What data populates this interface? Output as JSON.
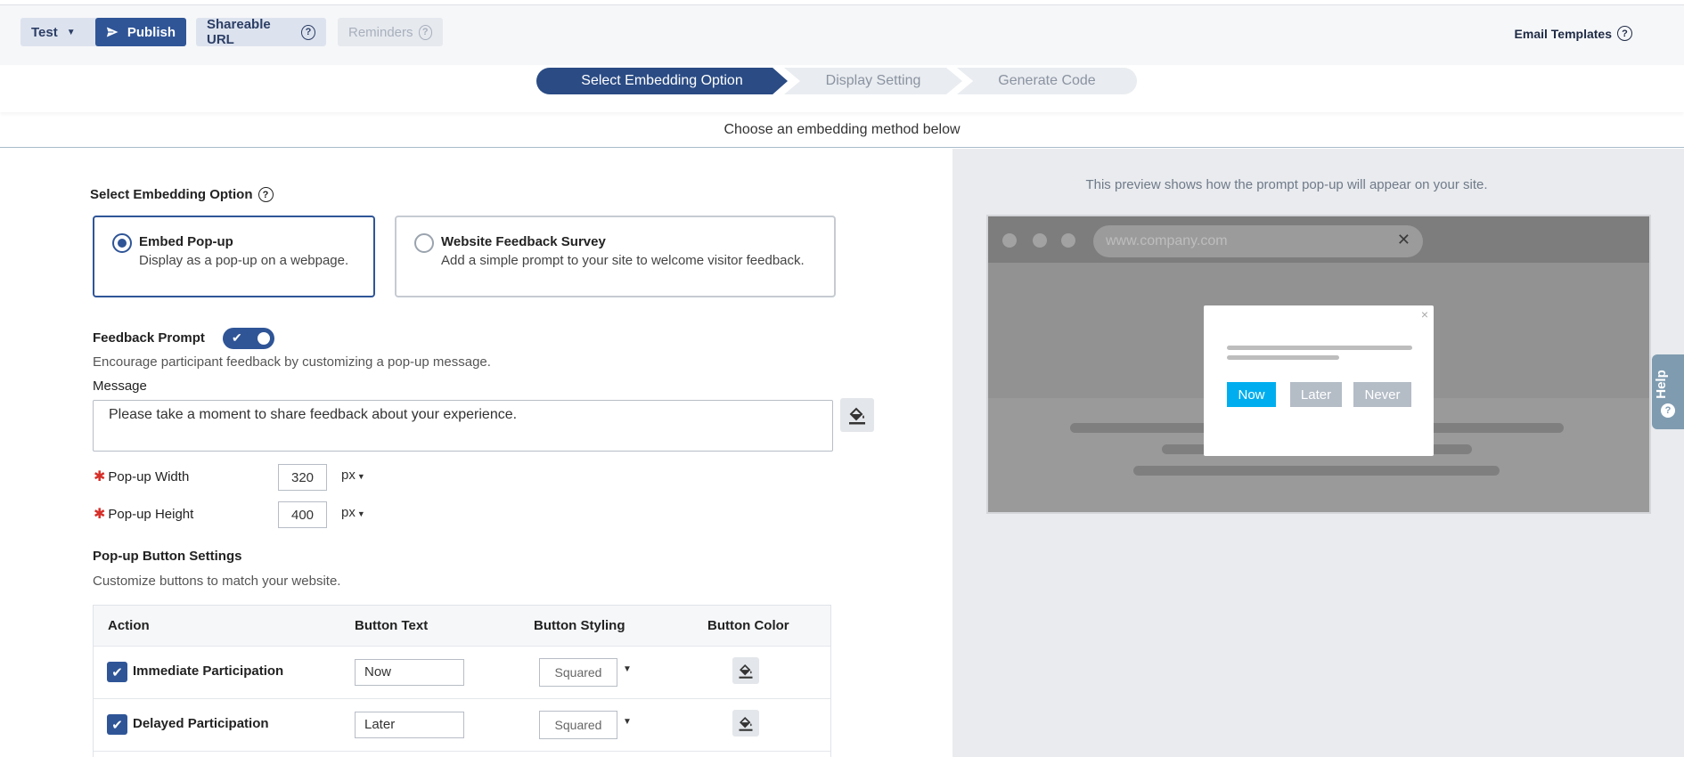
{
  "toolbar": {
    "test_label": "Test",
    "publish_label": "Publish",
    "share_label": "Shareable URL",
    "reminders_label": "Reminders",
    "email_templates_label": "Email Templates"
  },
  "steps": [
    {
      "label": "Select Embedding Option",
      "active": true
    },
    {
      "label": "Display Setting",
      "active": false
    },
    {
      "label": "Generate Code",
      "active": false
    }
  ],
  "subheading": "Choose an embedding method below",
  "embedding": {
    "title": "Select Embedding Option",
    "options": [
      {
        "title": "Embed Pop-up",
        "desc": "Display as a pop-up on a webpage.",
        "selected": true
      },
      {
        "title": "Website Feedback Survey",
        "desc": "Add a simple prompt to your site to welcome visitor feedback.",
        "selected": false
      }
    ]
  },
  "feedback_prompt": {
    "title": "Feedback Prompt",
    "enabled": true,
    "description": "Encourage participant feedback by customizing a pop-up message.",
    "message_label": "Message",
    "message_value": "Please take a moment to share feedback about your experience."
  },
  "dimensions": {
    "width_label": "Pop-up Width",
    "width_value": "320",
    "height_label": "Pop-up Height",
    "height_value": "400",
    "unit": "px"
  },
  "button_settings": {
    "title": "Pop-up Button Settings",
    "description": "Customize buttons to match your website.",
    "columns": [
      "Action",
      "Button Text",
      "Button Styling",
      "Button Color"
    ],
    "rows": [
      {
        "action": "Immediate Participation",
        "text": "Now",
        "styling": "Squared",
        "checked": true
      },
      {
        "action": "Delayed Participation",
        "text": "Later",
        "styling": "Squared",
        "checked": true
      }
    ]
  },
  "preview": {
    "note": "This preview shows how the prompt pop-up will appear on your site.",
    "url": "www.company.com",
    "buttons": [
      {
        "label": "Now",
        "color": "#00aeef"
      },
      {
        "label": "Later",
        "color": "#b4bcc6"
      },
      {
        "label": "Never",
        "color": "#b4bcc6"
      }
    ]
  },
  "help_label": "Help",
  "colors": {
    "accent": "#2f5597",
    "step_active": "#2a4b84",
    "preview_bg": "#e9ebee"
  }
}
